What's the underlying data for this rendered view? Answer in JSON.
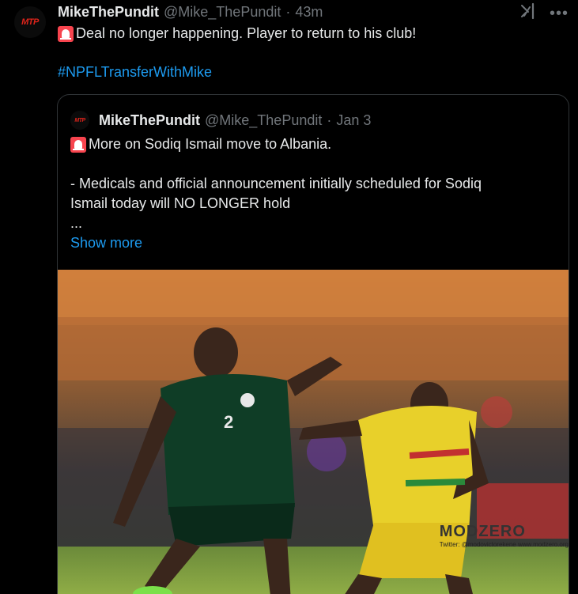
{
  "tweet": {
    "avatar_logo_text": "MTP",
    "display_name": "MikeThePundit",
    "handle": "@Mike_ThePundit",
    "separator": "·",
    "time": "43m",
    "text": "Deal no longer happening. Player to return to his club!",
    "hashtag": "#NPFLTransferWithMike",
    "more_icon": "more-horizontal-icon",
    "grok_icon": "grok-icon"
  },
  "quoted": {
    "avatar_logo_text": "MTP",
    "display_name": "MikeThePundit",
    "handle": "@Mike_ThePundit",
    "separator": "·",
    "date": "Jan 3",
    "line1": "More on Sodiq Ismail move to Albania.",
    "line2": "- Medicals and official announcement initially scheduled for Sodiq",
    "line3": "Ismail today will NO LONGER hold",
    "line4": "...",
    "show_more": "Show more",
    "watermark_title": "MODZERO",
    "watermark_sub": "Twitter: @modovictorekene   www.modzero.org",
    "jersey_number_left": "2"
  },
  "colors": {
    "background": "#000000",
    "text": "#e7e9ea",
    "muted": "#71767b",
    "link": "#1d9bf0",
    "border": "#2f3336",
    "siren": "#f7444e"
  }
}
